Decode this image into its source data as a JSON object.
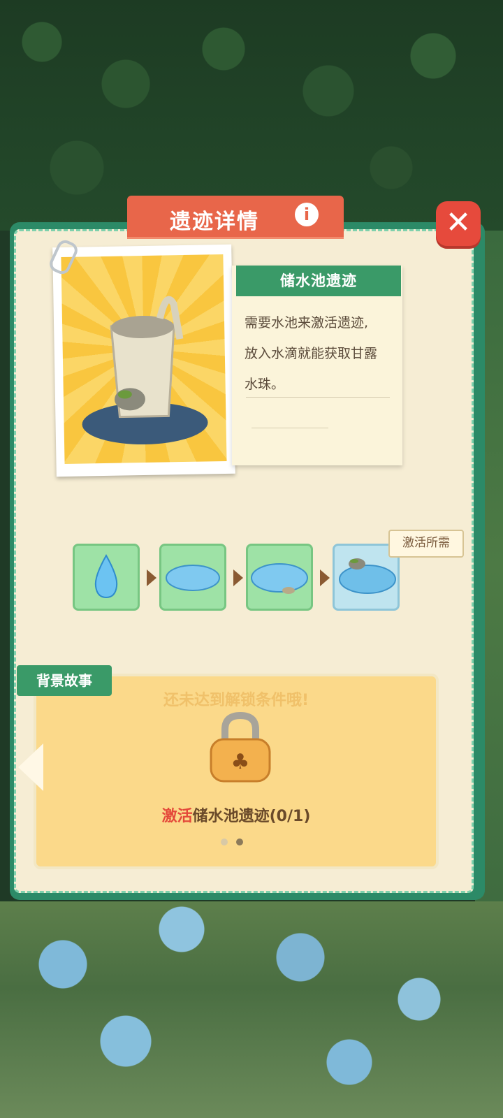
{
  "header": {
    "title": "遗迹详情",
    "info_icon": "info-icon"
  },
  "close_icon": "close-icon",
  "ruin": {
    "name": "储水池遗迹",
    "description_lines": [
      "需要水池来激活遗迹,",
      "放入水滴就能获取甘露",
      "水珠。"
    ]
  },
  "evolution": {
    "stages": [
      "water-drop-icon",
      "small-puddle-icon",
      "puddle-with-stone-icon",
      "pond-with-rock-icon"
    ],
    "activate_label": "激活所需"
  },
  "story": {
    "tab_label": "背景故事",
    "locked_message": "还未达到解锁条件哦!",
    "lock_icon": "lock-icon",
    "progress_highlight": "激活",
    "progress_rest": "储水池遗迹(0/1)",
    "page_dots": 2,
    "active_page": 2
  },
  "colors": {
    "accent_green": "#3a9a68",
    "title_red": "#e8664a",
    "highlight_red": "#e4493a"
  }
}
